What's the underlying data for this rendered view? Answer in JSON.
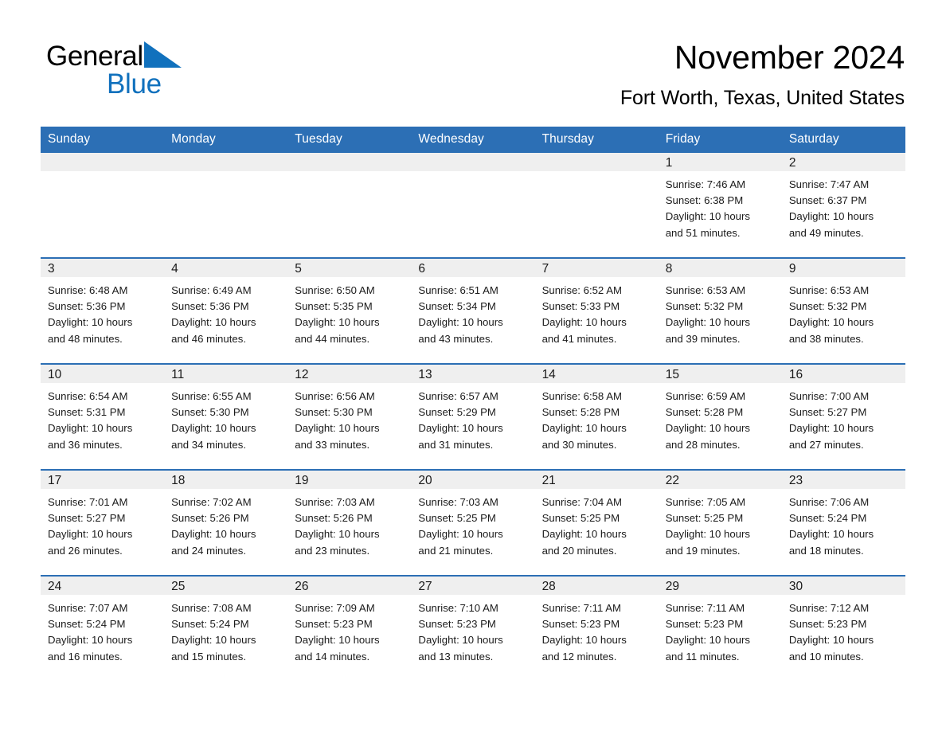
{
  "brand": {
    "name_part1": "General",
    "name_part2": "Blue",
    "logo_icon": "blue-triangle-icon",
    "accent_color": "#1171bd"
  },
  "header": {
    "title": "November 2024",
    "subtitle": "Fort Worth, Texas, United States"
  },
  "calendar": {
    "header_bg": "#2c6fb5",
    "daynum_bg": "#efefef",
    "weekdays": [
      "Sunday",
      "Monday",
      "Tuesday",
      "Wednesday",
      "Thursday",
      "Friday",
      "Saturday"
    ],
    "weeks": [
      [
        {
          "day": "",
          "empty": true
        },
        {
          "day": "",
          "empty": true
        },
        {
          "day": "",
          "empty": true
        },
        {
          "day": "",
          "empty": true
        },
        {
          "day": "",
          "empty": true
        },
        {
          "day": "1",
          "sunrise": "Sunrise: 7:46 AM",
          "sunset": "Sunset: 6:38 PM",
          "daylight1": "Daylight: 10 hours",
          "daylight2": "and 51 minutes."
        },
        {
          "day": "2",
          "sunrise": "Sunrise: 7:47 AM",
          "sunset": "Sunset: 6:37 PM",
          "daylight1": "Daylight: 10 hours",
          "daylight2": "and 49 minutes."
        }
      ],
      [
        {
          "day": "3",
          "sunrise": "Sunrise: 6:48 AM",
          "sunset": "Sunset: 5:36 PM",
          "daylight1": "Daylight: 10 hours",
          "daylight2": "and 48 minutes."
        },
        {
          "day": "4",
          "sunrise": "Sunrise: 6:49 AM",
          "sunset": "Sunset: 5:36 PM",
          "daylight1": "Daylight: 10 hours",
          "daylight2": "and 46 minutes."
        },
        {
          "day": "5",
          "sunrise": "Sunrise: 6:50 AM",
          "sunset": "Sunset: 5:35 PM",
          "daylight1": "Daylight: 10 hours",
          "daylight2": "and 44 minutes."
        },
        {
          "day": "6",
          "sunrise": "Sunrise: 6:51 AM",
          "sunset": "Sunset: 5:34 PM",
          "daylight1": "Daylight: 10 hours",
          "daylight2": "and 43 minutes."
        },
        {
          "day": "7",
          "sunrise": "Sunrise: 6:52 AM",
          "sunset": "Sunset: 5:33 PM",
          "daylight1": "Daylight: 10 hours",
          "daylight2": "and 41 minutes."
        },
        {
          "day": "8",
          "sunrise": "Sunrise: 6:53 AM",
          "sunset": "Sunset: 5:32 PM",
          "daylight1": "Daylight: 10 hours",
          "daylight2": "and 39 minutes."
        },
        {
          "day": "9",
          "sunrise": "Sunrise: 6:53 AM",
          "sunset": "Sunset: 5:32 PM",
          "daylight1": "Daylight: 10 hours",
          "daylight2": "and 38 minutes."
        }
      ],
      [
        {
          "day": "10",
          "sunrise": "Sunrise: 6:54 AM",
          "sunset": "Sunset: 5:31 PM",
          "daylight1": "Daylight: 10 hours",
          "daylight2": "and 36 minutes."
        },
        {
          "day": "11",
          "sunrise": "Sunrise: 6:55 AM",
          "sunset": "Sunset: 5:30 PM",
          "daylight1": "Daylight: 10 hours",
          "daylight2": "and 34 minutes."
        },
        {
          "day": "12",
          "sunrise": "Sunrise: 6:56 AM",
          "sunset": "Sunset: 5:30 PM",
          "daylight1": "Daylight: 10 hours",
          "daylight2": "and 33 minutes."
        },
        {
          "day": "13",
          "sunrise": "Sunrise: 6:57 AM",
          "sunset": "Sunset: 5:29 PM",
          "daylight1": "Daylight: 10 hours",
          "daylight2": "and 31 minutes."
        },
        {
          "day": "14",
          "sunrise": "Sunrise: 6:58 AM",
          "sunset": "Sunset: 5:28 PM",
          "daylight1": "Daylight: 10 hours",
          "daylight2": "and 30 minutes."
        },
        {
          "day": "15",
          "sunrise": "Sunrise: 6:59 AM",
          "sunset": "Sunset: 5:28 PM",
          "daylight1": "Daylight: 10 hours",
          "daylight2": "and 28 minutes."
        },
        {
          "day": "16",
          "sunrise": "Sunrise: 7:00 AM",
          "sunset": "Sunset: 5:27 PM",
          "daylight1": "Daylight: 10 hours",
          "daylight2": "and 27 minutes."
        }
      ],
      [
        {
          "day": "17",
          "sunrise": "Sunrise: 7:01 AM",
          "sunset": "Sunset: 5:27 PM",
          "daylight1": "Daylight: 10 hours",
          "daylight2": "and 26 minutes."
        },
        {
          "day": "18",
          "sunrise": "Sunrise: 7:02 AM",
          "sunset": "Sunset: 5:26 PM",
          "daylight1": "Daylight: 10 hours",
          "daylight2": "and 24 minutes."
        },
        {
          "day": "19",
          "sunrise": "Sunrise: 7:03 AM",
          "sunset": "Sunset: 5:26 PM",
          "daylight1": "Daylight: 10 hours",
          "daylight2": "and 23 minutes."
        },
        {
          "day": "20",
          "sunrise": "Sunrise: 7:03 AM",
          "sunset": "Sunset: 5:25 PM",
          "daylight1": "Daylight: 10 hours",
          "daylight2": "and 21 minutes."
        },
        {
          "day": "21",
          "sunrise": "Sunrise: 7:04 AM",
          "sunset": "Sunset: 5:25 PM",
          "daylight1": "Daylight: 10 hours",
          "daylight2": "and 20 minutes."
        },
        {
          "day": "22",
          "sunrise": "Sunrise: 7:05 AM",
          "sunset": "Sunset: 5:25 PM",
          "daylight1": "Daylight: 10 hours",
          "daylight2": "and 19 minutes."
        },
        {
          "day": "23",
          "sunrise": "Sunrise: 7:06 AM",
          "sunset": "Sunset: 5:24 PM",
          "daylight1": "Daylight: 10 hours",
          "daylight2": "and 18 minutes."
        }
      ],
      [
        {
          "day": "24",
          "sunrise": "Sunrise: 7:07 AM",
          "sunset": "Sunset: 5:24 PM",
          "daylight1": "Daylight: 10 hours",
          "daylight2": "and 16 minutes."
        },
        {
          "day": "25",
          "sunrise": "Sunrise: 7:08 AM",
          "sunset": "Sunset: 5:24 PM",
          "daylight1": "Daylight: 10 hours",
          "daylight2": "and 15 minutes."
        },
        {
          "day": "26",
          "sunrise": "Sunrise: 7:09 AM",
          "sunset": "Sunset: 5:23 PM",
          "daylight1": "Daylight: 10 hours",
          "daylight2": "and 14 minutes."
        },
        {
          "day": "27",
          "sunrise": "Sunrise: 7:10 AM",
          "sunset": "Sunset: 5:23 PM",
          "daylight1": "Daylight: 10 hours",
          "daylight2": "and 13 minutes."
        },
        {
          "day": "28",
          "sunrise": "Sunrise: 7:11 AM",
          "sunset": "Sunset: 5:23 PM",
          "daylight1": "Daylight: 10 hours",
          "daylight2": "and 12 minutes."
        },
        {
          "day": "29",
          "sunrise": "Sunrise: 7:11 AM",
          "sunset": "Sunset: 5:23 PM",
          "daylight1": "Daylight: 10 hours",
          "daylight2": "and 11 minutes."
        },
        {
          "day": "30",
          "sunrise": "Sunrise: 7:12 AM",
          "sunset": "Sunset: 5:23 PM",
          "daylight1": "Daylight: 10 hours",
          "daylight2": "and 10 minutes."
        }
      ]
    ]
  }
}
